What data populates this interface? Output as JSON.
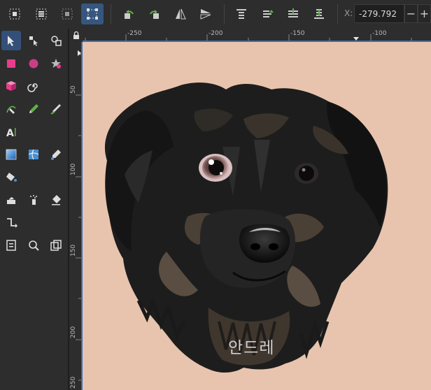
{
  "toolbar": {
    "x_label": "X:",
    "x_value": "-279.792",
    "minus": "−",
    "plus": "+"
  },
  "ruler": {
    "h_ticks": [
      "-250",
      "-200",
      "-150",
      "-100"
    ],
    "v_ticks": [
      "50",
      "100",
      "150",
      "200",
      "250"
    ]
  },
  "canvas": {
    "caption": "안드레",
    "background": "#e8c4ae"
  },
  "colors": {
    "accent": "#3b6fb3",
    "active_tool": "#34507a"
  }
}
